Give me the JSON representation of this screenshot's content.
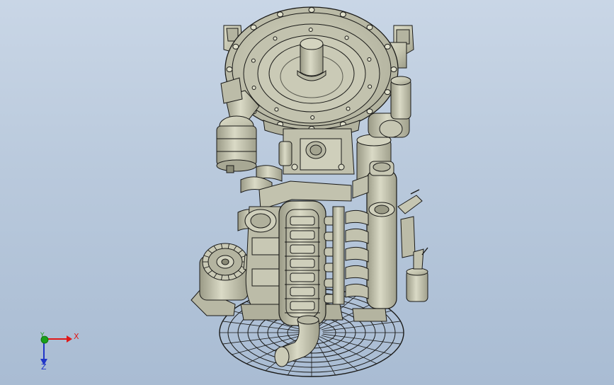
{
  "viewport": {
    "background_top": "#c9d6e6",
    "background_bottom": "#a9bcd3",
    "model_color": "#c8c8b4",
    "edge_color": "#1a1a18",
    "shadow_color": "#8f8f7e"
  },
  "triad": {
    "x_label": "X",
    "y_label": "Y",
    "z_label": "Z",
    "x_color": "#e01818",
    "y_color": "#19a019",
    "z_color": "#2036c8"
  }
}
